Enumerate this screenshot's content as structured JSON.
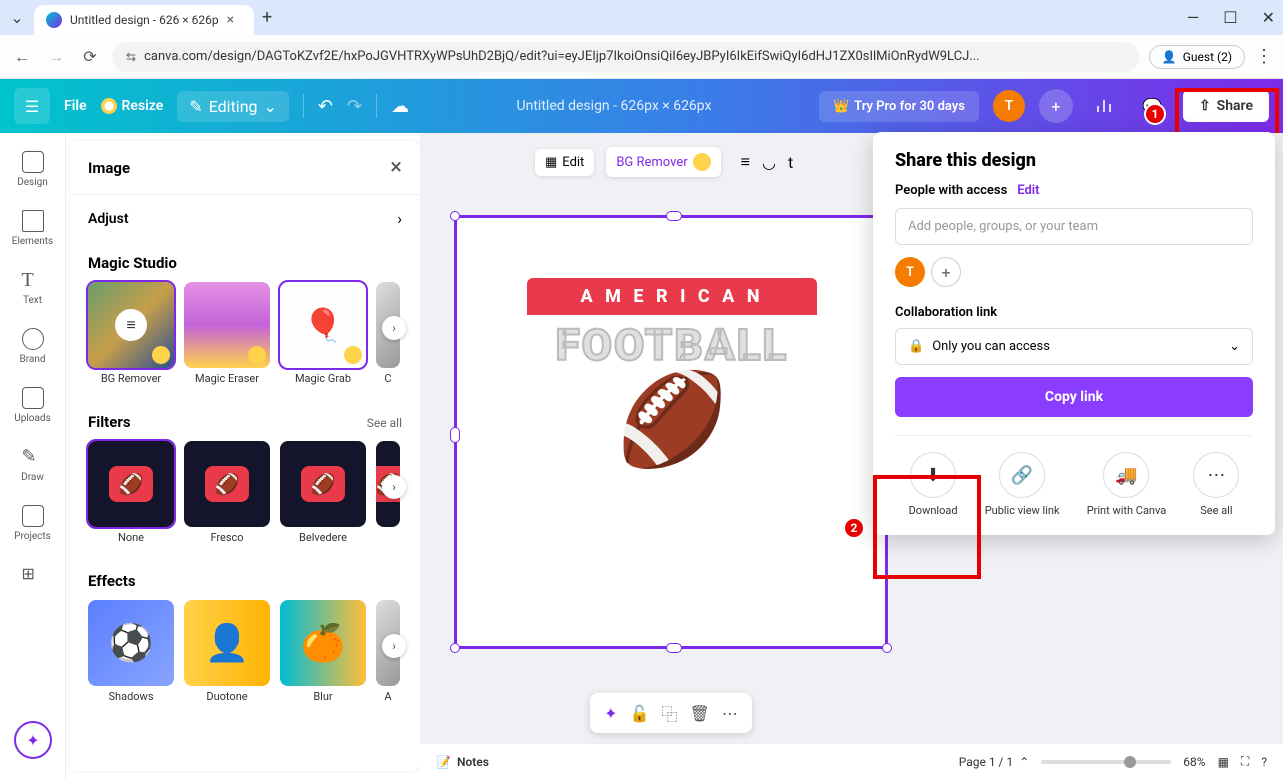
{
  "browser": {
    "tab_title": "Untitled design - 626 × 626p",
    "url": "canva.com/design/DAGToKZvf2E/hxPoJGVHTRXyWPsUhD2BjQ/edit?ui=eyJEIjp7IkoiOnsiQiI6eyJBPyI6IkEifSwiQyI6dHJ1ZX0sIlMiOnRydW9LCJ...",
    "guest": "Guest (2)"
  },
  "canva_bar": {
    "file": "File",
    "resize": "Resize",
    "editing": "Editing",
    "design_name": "Untitled design - 626px × 626px",
    "try_pro": "Try Pro for 30 days",
    "avatar_letter": "T",
    "share": "Share"
  },
  "rail": {
    "design": "Design",
    "elements": "Elements",
    "text": "Text",
    "brand": "Brand",
    "uploads": "Uploads",
    "draw": "Draw",
    "projects": "Projects"
  },
  "panel": {
    "title": "Image",
    "adjust": "Adjust",
    "magic_studio": "Magic Studio",
    "magic_items": {
      "bg_remover": "BG Remover",
      "magic_eraser": "Magic Eraser",
      "magic_grab": "Magic Grab",
      "extra": "C"
    },
    "filters": "Filters",
    "see_all": "See all",
    "filter_items": {
      "none": "None",
      "fresco": "Fresco",
      "belvedere": "Belvedere"
    },
    "effects": "Effects",
    "effect_items": {
      "shadows": "Shadows",
      "duotone": "Duotone",
      "blur": "Blur",
      "extra": "A"
    }
  },
  "ctx": {
    "edit": "Edit",
    "bg_remover": "BG Remover"
  },
  "logo": {
    "line1": "A M E R I C A N",
    "line2": "FOOTBALL"
  },
  "share_popup": {
    "title": "Share this design",
    "access_label": "People with access",
    "edit": "Edit",
    "input_placeholder": "Add people, groups, or your team",
    "avatar_letter": "T",
    "collab_label": "Collaboration link",
    "collab_value": "Only you can access",
    "copy": "Copy link",
    "download": "Download",
    "public": "Public view link",
    "print": "Print with Canva",
    "see_all": "See all"
  },
  "bottom": {
    "notes": "Notes",
    "page": "Page 1 / 1",
    "zoom": "68%"
  },
  "annotations": {
    "one": "1",
    "two": "2"
  }
}
